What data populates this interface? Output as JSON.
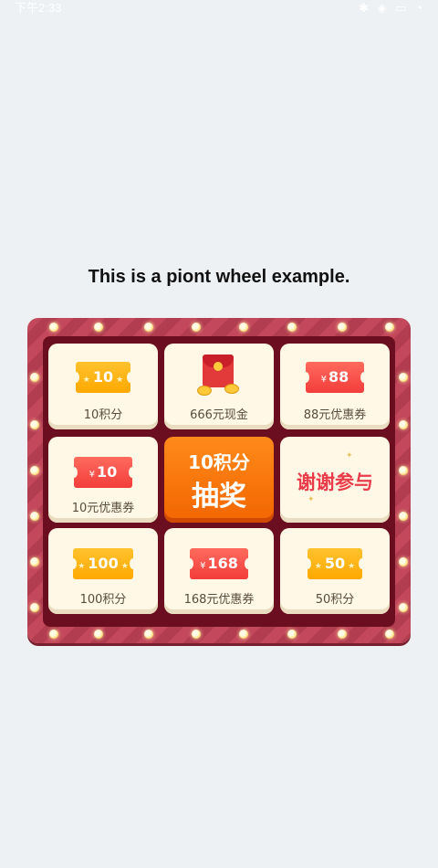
{
  "status_bar": {
    "time": "下午2:33",
    "icons": "✱ ◈ ▭ ◔"
  },
  "title": "This is a piont wheel example.",
  "wheel": {
    "prizes": {
      "top_left": {
        "badge": "10",
        "label": "10积分",
        "style": "gold-ticket"
      },
      "top_center": {
        "label": "666元现金",
        "icon": "red-envelope-icon"
      },
      "top_right": {
        "badge": "88",
        "currency": "¥",
        "label": "88元优惠券",
        "style": "red-ticket"
      },
      "middle_left": {
        "badge": "10",
        "currency": "¥",
        "label": "10元优惠券",
        "style": "red-ticket"
      },
      "middle_right": {
        "text": "谢谢参与"
      },
      "bottom_left": {
        "badge": "100",
        "label": "100积分",
        "style": "gold-ticket"
      },
      "bottom_center": {
        "badge": "168",
        "currency": "¥",
        "label": "168元优惠券",
        "style": "red-ticket"
      },
      "bottom_right": {
        "badge": "50",
        "label": "50积分",
        "style": "gold-ticket"
      }
    },
    "draw_button": {
      "line1": "10积分",
      "line2": "抽奖"
    }
  },
  "colors": {
    "board": "#c3485c",
    "inner": "#6b0f20",
    "cell": "#fff8e6",
    "draw_button": "#f26500",
    "gold_ticket": "#ffa800",
    "red_ticket": "#f33d3a"
  }
}
